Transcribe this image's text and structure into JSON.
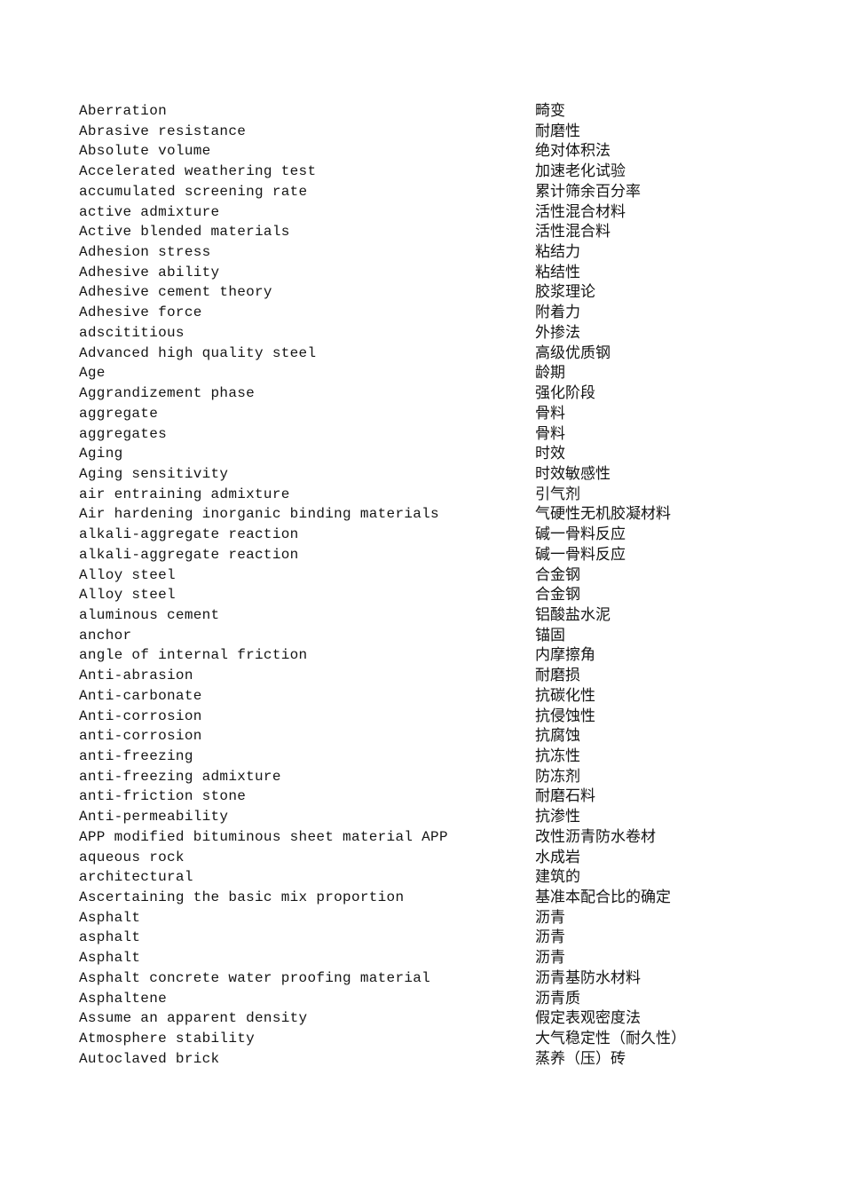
{
  "document": {
    "type": "bilingual glossary",
    "entries": [
      {
        "en": "Aberration",
        "zh": "畸变"
      },
      {
        "en": "Abrasive resistance",
        "zh": "耐磨性"
      },
      {
        "en": "Absolute volume",
        "zh": "绝对体积法"
      },
      {
        "en": "Accelerated weathering test",
        "zh": "加速老化试验"
      },
      {
        "en": "accumulated screening rate",
        "zh": "累计筛余百分率"
      },
      {
        "en": "active admixture",
        "zh": "活性混合材料"
      },
      {
        "en": "Active blended materials",
        "zh": "活性混合料"
      },
      {
        "en": "Adhesion stress",
        "zh": "粘结力"
      },
      {
        "en": "Adhesive ability",
        "zh": "粘结性"
      },
      {
        "en": "Adhesive cement theory",
        "zh": "胶浆理论"
      },
      {
        "en": "Adhesive force",
        "zh": "附着力"
      },
      {
        "en": "adscititious",
        "zh": "外掺法"
      },
      {
        "en": "Advanced high quality steel",
        "zh": "高级优质钢"
      },
      {
        "en": "Age",
        "zh": "龄期"
      },
      {
        "en": "Aggrandizement phase",
        "zh": "强化阶段"
      },
      {
        "en": "aggregate",
        "zh": "骨料"
      },
      {
        "en": "aggregates",
        "zh": "骨料"
      },
      {
        "en": "Aging",
        "zh": "时效"
      },
      {
        "en": "Aging sensitivity",
        "zh": "时效敏感性"
      },
      {
        "en": "air entraining admixture",
        "zh": "引气剂"
      },
      {
        "en": "Air hardening inorganic binding materials",
        "zh": "气硬性无机胶凝材料"
      },
      {
        "en": "alkali-aggregate reaction",
        "zh": "碱一骨料反应"
      },
      {
        "en": "alkali-aggregate reaction",
        "zh": "碱一骨料反应"
      },
      {
        "en": "Alloy steel",
        "zh": "合金钢"
      },
      {
        "en": "Alloy steel",
        "zh": "合金钢"
      },
      {
        "en": "aluminous cement",
        "zh": "铝酸盐水泥"
      },
      {
        "en": "anchor",
        "zh": "锚固"
      },
      {
        "en": "angle of internal friction",
        "zh": "内摩擦角"
      },
      {
        "en": "Anti-abrasion",
        "zh": "耐磨损"
      },
      {
        "en": "Anti-carbonate",
        "zh": "抗碳化性"
      },
      {
        "en": "Anti-corrosion",
        "zh": "抗侵蚀性"
      },
      {
        "en": "anti-corrosion",
        "zh": "抗腐蚀"
      },
      {
        "en": "anti-freezing",
        "zh": "抗冻性"
      },
      {
        "en": "anti-freezing admixture",
        "zh": "防冻剂"
      },
      {
        "en": "anti-friction stone",
        "zh": "耐磨石料"
      },
      {
        "en": "Anti-permeability",
        "zh": "抗渗性"
      },
      {
        "en": "APP modified bituminous sheet material APP",
        "zh": "改性沥青防水卷材"
      },
      {
        "en": "aqueous rock",
        "zh": "水成岩"
      },
      {
        "en": "architectural",
        "zh": "建筑的"
      },
      {
        "en": "Ascertaining the basic mix proportion",
        "zh": "基准本配合比的确定"
      },
      {
        "en": "Asphalt",
        "zh": "沥青"
      },
      {
        "en": "asphalt",
        "zh": "沥青"
      },
      {
        "en": "Asphalt",
        "zh": "沥青"
      },
      {
        "en": "Asphalt concrete water proofing material",
        "zh": "沥青基防水材料"
      },
      {
        "en": "Asphaltene",
        "zh": "沥青质"
      },
      {
        "en": "Assume an apparent density",
        "zh": "假定表观密度法"
      },
      {
        "en": "Atmosphere stability",
        "zh": "大气稳定性（耐久性）"
      },
      {
        "en": "Autoclaved brick",
        "zh": "蒸养（压）砖"
      }
    ]
  }
}
